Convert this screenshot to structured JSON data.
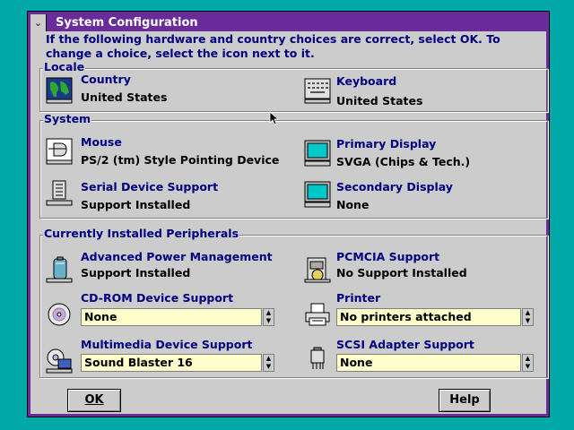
{
  "window": {
    "title": "System Configuration",
    "sysmenu_glyph": "⌄",
    "instructions": "If the following hardware and country choices are correct, select OK. To change a choice, select the icon next to it."
  },
  "groups": {
    "locale": "Locale",
    "system": "System",
    "peripherals": "Currently Installed Peripherals"
  },
  "locale": {
    "country": {
      "label": "Country",
      "value": "United States",
      "icon": "globe-icon"
    },
    "keyboard": {
      "label": "Keyboard",
      "value": "United States",
      "icon": "keyboard-icon"
    }
  },
  "system": {
    "mouse": {
      "label": "Mouse",
      "value": "PS/2 (tm) Style Pointing Device",
      "icon": "mouse-icon"
    },
    "primary_display": {
      "label": "Primary Display",
      "value": "SVGA (Chips & Tech.)",
      "icon": "monitor-icon"
    },
    "serial": {
      "label": "Serial Device Support",
      "value": "Support Installed",
      "icon": "serial-port-icon"
    },
    "secondary_display": {
      "label": "Secondary Display",
      "value": "None",
      "icon": "monitor-icon"
    }
  },
  "peripherals": {
    "apm": {
      "label": "Advanced Power Management",
      "value": "Support Installed",
      "icon": "battery-icon"
    },
    "pcmcia": {
      "label": "PCMCIA Support",
      "value": "No Support Installed",
      "icon": "pcmcia-icon"
    },
    "cdrom": {
      "label": "CD-ROM Device Support",
      "value": "None",
      "icon": "cd-icon"
    },
    "printer": {
      "label": "Printer",
      "value": "No printers attached",
      "icon": "printer-icon"
    },
    "multimedia": {
      "label": "Multimedia Device Support",
      "value": "Sound Blaster 16",
      "icon": "multimedia-icon"
    },
    "scsi": {
      "label": "SCSI Adapter Support",
      "value": "None",
      "icon": "scsi-icon"
    }
  },
  "buttons": {
    "ok": "OK",
    "help": "Help"
  },
  "colors": {
    "desktop": "#00a8a8",
    "titlebar": "#6a2c9a",
    "label_blue": "#000080",
    "field_yellow": "#ffffcc"
  }
}
